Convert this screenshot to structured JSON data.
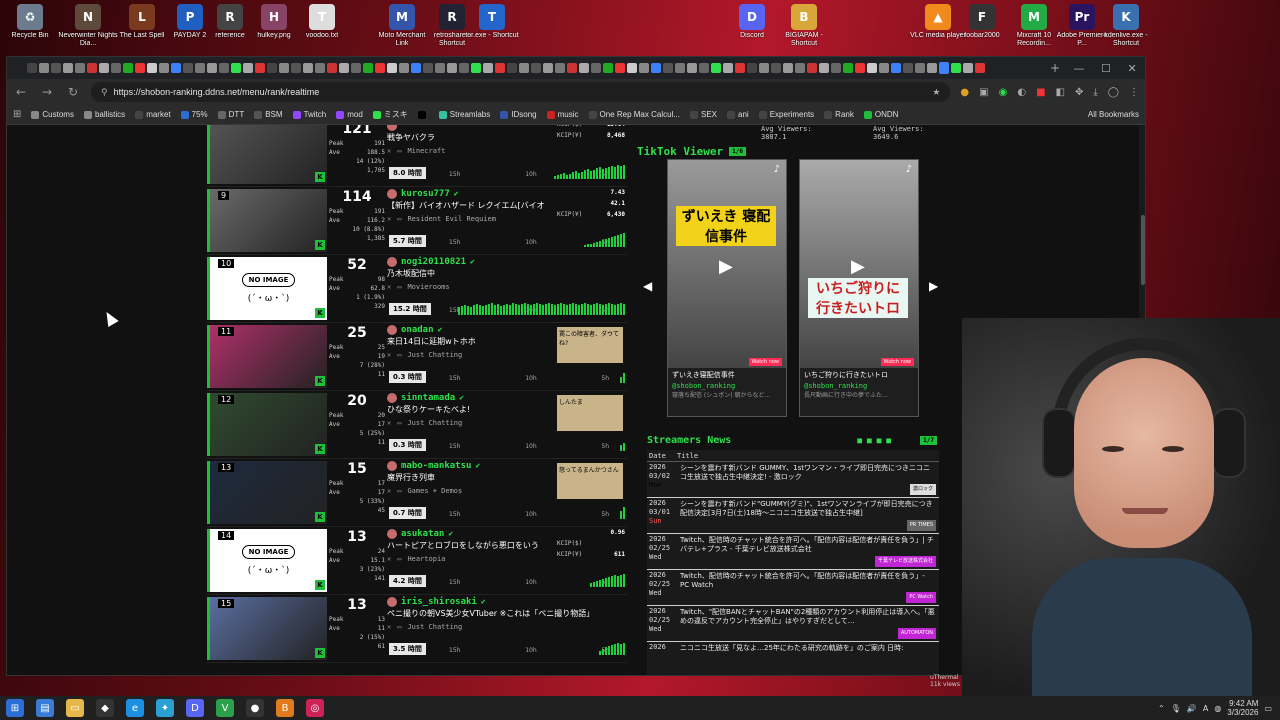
{
  "desktop": {
    "icons": [
      {
        "label": "Recycle Bin",
        "color": "#6b7c8f",
        "glyph": "♻"
      },
      {
        "label": "Neverwinter Nights Dia...",
        "color": "#5d4a3a",
        "glyph": "N"
      },
      {
        "label": "The Last Spell",
        "color": "#7a3a20",
        "glyph": "L"
      },
      {
        "label": "PAYDAY 2",
        "color": "#1f5fbf",
        "glyph": "P"
      },
      {
        "label": "reference",
        "color": "#444444",
        "glyph": "R"
      },
      {
        "label": "hulkey.png",
        "color": "#884466",
        "glyph": "H"
      },
      {
        "label": "voodoo.txt",
        "color": "#dddddd",
        "glyph": "T"
      },
      {
        "label": "Moto Merchant Link",
        "color": "#3355aa",
        "glyph": "M"
      },
      {
        "label": "retroshare - Shortcut",
        "color": "#222233",
        "glyph": "R"
      },
      {
        "label": "tor.exe - Shortcut",
        "color": "#2266cc",
        "glyph": "T"
      },
      {
        "label": "Discord",
        "color": "#5865f2",
        "glyph": "D"
      },
      {
        "label": "BIGIAPAM - Shortcut",
        "color": "#d9a63a",
        "glyph": "B"
      },
      {
        "label": "VLC media player",
        "color": "#f08a1c",
        "glyph": "▲"
      },
      {
        "label": "foobar2000",
        "color": "#333333",
        "glyph": "F"
      },
      {
        "label": "Mixcraft 10 Recordin...",
        "color": "#22aa44",
        "glyph": "M"
      },
      {
        "label": "Adobe Premiere P...",
        "color": "#2a1460",
        "glyph": "Pr"
      },
      {
        "label": "kdenlive.exe - Shortcut",
        "color": "#3a6fb0",
        "glyph": "K"
      }
    ]
  },
  "browser": {
    "url": "https://shobon-ranking.ddns.net/menu/rank/realtime",
    "window_controls": [
      "—",
      "☐",
      "✕"
    ],
    "new_tab": "+",
    "bookmarks": [
      {
        "label": "Customs",
        "color": "#888888"
      },
      {
        "label": "ballistics",
        "color": "#888888"
      },
      {
        "label": "market",
        "color": "#444444"
      },
      {
        "label": "75%",
        "color": "#2b6fd6"
      },
      {
        "label": "DTT",
        "color": "#666666"
      },
      {
        "label": "BSM",
        "color": "#555555"
      },
      {
        "label": "Twitch",
        "color": "#9146ff"
      },
      {
        "label": "mod",
        "color": "#9146ff"
      },
      {
        "label": "ミスキ",
        "color": "#2ee04b"
      },
      {
        "label": "",
        "color": "#000000"
      },
      {
        "label": "Streamlabs",
        "color": "#31c3a2"
      },
      {
        "label": "IDsong",
        "color": "#3355aa"
      },
      {
        "label": "music",
        "color": "#cc2222"
      },
      {
        "label": "One Rep Max Calcul...",
        "color": "#444444"
      },
      {
        "label": "SEX",
        "color": "#444444"
      },
      {
        "label": "ani",
        "color": "#444444"
      },
      {
        "label": "Experiments",
        "color": "#444444"
      },
      {
        "label": "Rank",
        "color": "#444444"
      },
      {
        "label": "ONDN",
        "color": "#1fbf3a"
      }
    ],
    "all_bookmarks": "All Bookmarks"
  },
  "ranking": {
    "rows": [
      {
        "rank": "",
        "viewers": "121",
        "stats": [
          [
            "Peak",
            "191"
          ],
          [
            "Ave",
            "188.5"
          ],
          [
            "",
            "14 (12%)"
          ],
          [
            "",
            "1,705"
          ]
        ],
        "name": "",
        "title": "戦争ヤバクラ",
        "category": "Minecraft",
        "duration": "8.0 時間",
        "kcip": [
          [
            "KCIP($)",
            "15.64"
          ],
          [
            "KCIP(¥)",
            "8,468"
          ]
        ],
        "mini": "",
        "noimg": false,
        "thumbColor": "#555555",
        "spark": [
          3,
          4,
          5,
          6,
          4,
          5,
          7,
          8,
          6,
          7,
          9,
          10,
          8,
          9,
          11,
          12,
          10,
          11,
          12,
          13,
          12,
          14,
          13,
          14
        ]
      },
      {
        "rank": "9",
        "viewers": "114",
        "stats": [
          [
            "Peak",
            "191"
          ],
          [
            "Ave",
            "116.2"
          ],
          [
            "",
            "10 (8.8%)"
          ],
          [
            "",
            "1,385"
          ]
        ],
        "name": "kurosu777",
        "title": "【新作】バイオハザード レクイエム[バイオ",
        "category": "Resident Evil Requiem",
        "duration": "5.7 時間",
        "kcip": [
          [
            "",
            "7.43"
          ],
          [
            "",
            "42.1"
          ],
          [
            "KCIP(¥)",
            "6,430"
          ]
        ],
        "mini": "",
        "noimg": false,
        "thumbColor": "#6a6a6a",
        "spark": [
          2,
          3,
          3,
          4,
          5,
          6,
          7,
          8,
          9,
          10,
          11,
          12,
          13,
          14
        ]
      },
      {
        "rank": "10",
        "viewers": "52",
        "stats": [
          [
            "Peak",
            "98"
          ],
          [
            "Ave",
            "62.8"
          ],
          [
            "",
            "1 (1.9%)"
          ],
          [
            "",
            "329"
          ]
        ],
        "name": "nogi20110821",
        "title": "乃木坂配信中",
        "category": "Movierooms",
        "duration": "15.2 時間",
        "kcip": [],
        "mini": "",
        "noimg": true,
        "thumbColor": "#ffffff",
        "spark": [
          8,
          9,
          10,
          9,
          8,
          10,
          11,
          10,
          9,
          10,
          11,
          12,
          10,
          11,
          9,
          10,
          11,
          10,
          12,
          11,
          10,
          11,
          12,
          11,
          10,
          11,
          12,
          11,
          10,
          11,
          12,
          11,
          10,
          11,
          12,
          11,
          10,
          11,
          12,
          11,
          10,
          11,
          12,
          11,
          10,
          11,
          12,
          11,
          10,
          11,
          12,
          11,
          10,
          11,
          12,
          11
        ]
      },
      {
        "rank": "11",
        "viewers": "25",
        "stats": [
          [
            "Peak",
            "25"
          ],
          [
            "Ave",
            "19"
          ],
          [
            "",
            "7 (28%)"
          ],
          [
            "",
            "11"
          ]
        ],
        "name": "onadan",
        "title": "来日14日に延期wトホホ",
        "category": "Just Chatting",
        "duration": "0.3 時間",
        "kcip": [],
        "mini": "罠この障害者、ダウてね?",
        "noimg": false,
        "thumbColor": "#b0306a",
        "spark": [
          6,
          10
        ]
      },
      {
        "rank": "12",
        "viewers": "20",
        "stats": [
          [
            "Peak",
            "20"
          ],
          [
            "Ave",
            "17"
          ],
          [
            "",
            "5 (25%)"
          ],
          [
            "",
            "11"
          ]
        ],
        "name": "sinntamada",
        "title": "ひな祭りケーキたべよ!",
        "category": "Just Chatting",
        "duration": "0.3 時間",
        "kcip": [],
        "mini": "しんたま",
        "noimg": false,
        "thumbColor": "#2f4a2f",
        "spark": [
          6,
          8
        ]
      },
      {
        "rank": "13",
        "viewers": "15",
        "stats": [
          [
            "Peak",
            "17"
          ],
          [
            "Ave",
            "17"
          ],
          [
            "",
            "5 (33%)"
          ],
          [
            "",
            "45"
          ]
        ],
        "name": "mabo-mankatsu",
        "title": "魔界行き列車",
        "category": "Games + Demos",
        "duration": "0.7 時間",
        "kcip": [],
        "mini": "怒ってるまんかつさん",
        "noimg": false,
        "thumbColor": "#1e2a3e",
        "spark": [
          8,
          12
        ]
      },
      {
        "rank": "14",
        "viewers": "13",
        "stats": [
          [
            "Peak",
            "24"
          ],
          [
            "Ave",
            "15.1"
          ],
          [
            "",
            "3 (23%)"
          ],
          [
            "",
            "141"
          ]
        ],
        "name": "asukatan",
        "title": "ハートピアとロブロをしながら悪口をいう",
        "category": "Heartopia",
        "duration": "4.2 時間",
        "kcip": [
          [
            "",
            "0.96"
          ],
          [
            "KCIP($)",
            ""
          ],
          [
            "KCIP(¥)",
            "611"
          ]
        ],
        "mini": "",
        "noimg": true,
        "thumbColor": "#ffffff",
        "spark": [
          4,
          5,
          6,
          7,
          8,
          9,
          10,
          11,
          12,
          11,
          12,
          13
        ]
      },
      {
        "rank": "15",
        "viewers": "13",
        "stats": [
          [
            "Peak",
            "13"
          ],
          [
            "Ave",
            "11"
          ],
          [
            "",
            "2 (15%)"
          ],
          [
            "",
            "61"
          ]
        ],
        "name": "iris_shirosaki",
        "title": "ペニ撮りの朝VS美少女VTuber ※これは「ペニ撮り物語」",
        "category": "Just Chatting",
        "duration": "3.5 時間",
        "kcip": [],
        "mini": "",
        "noimg": false,
        "thumbColor": "#5a6ea0",
        "spark": [
          4,
          6,
          8,
          9,
          10,
          11,
          12,
          11,
          12
        ]
      }
    ],
    "ticks": [
      "15h",
      "10h",
      "5h"
    ]
  },
  "right": {
    "avg": [
      "Avg Viewers: 3887.1",
      "Avg Viewers: 3649.6"
    ],
    "tiktok_title": "TikTok Viewer",
    "tiktok_badge": "1/6",
    "cards": [
      {
        "tag": "ずいえき 寝配信事件",
        "caption": "ずいえき寝配信事件",
        "user": "@shobon_ranking",
        "desc": "寝落ち配信 (シュボン) 朝からなど...",
        "watch": "Watch now",
        "bg": "#9a9a9a"
      },
      {
        "tag": "いちご狩りに 行きたいトロ",
        "caption": "いちご狩りに行きたいトロ",
        "user": "@shobon_ranking",
        "desc": "長尺動画に行き中の夢でふた...",
        "watch": "Watch now",
        "bg": "#aaaaaa"
      }
    ],
    "news_title": "Streamers News",
    "news_badge": "1/7",
    "news_cols": [
      "Date",
      "Title"
    ],
    "news": [
      {
        "y": "2026",
        "d": "03/02",
        "day": "Mon",
        "t": "シーンを震わす新バンド GUMMY、1stワンマン・ライブ即日完売につきニコニコ生放送で独占生中継決定! - 激ロック",
        "src": "激ロック",
        "srcColor": "#dddddd"
      },
      {
        "y": "2026",
        "d": "03/01",
        "day": "Sun",
        "t": "シーンを震わす新バンド\"GUMMY(グミ)\"、1stワンマンライブが即日完売につき配信決定[3月7日(土)18時〜ニコニコ生放送で独占生中継]",
        "src": "PR TIMES",
        "srcColor": "#666666"
      },
      {
        "y": "2026",
        "d": "02/25",
        "day": "Wed",
        "t": "Twitch、配信時のチャット統合を許可へ。「配信内容は配信者が責任を負う」| チバテレ+プラス - 千葉テレビ放送株式会社",
        "src": "千葉テレビ放送株式会社",
        "srcColor": "#c026d3"
      },
      {
        "y": "2026",
        "d": "02/25",
        "day": "Wed",
        "t": "Twitch、配信時のチャット統合を許可へ。「配信内容は配信者が責任を負う」- PC Watch",
        "src": "PC Watch",
        "srcColor": "#c026d3"
      },
      {
        "y": "2026",
        "d": "02/25",
        "day": "Wed",
        "t": "Twitch、\"配信BANとチャットBAN\"の2種類のアカウント利用停止は導入へ。「悪めの違反でアカウント完全停止」はやりすぎだとして...",
        "src": "AUTOMATON",
        "srcColor": "#c026d3"
      },
      {
        "y": "2026",
        "d": "",
        "day": "",
        "t": "ニコニコ生放送「見なよ…25年にわたる研究の軌跡を」のご案内 日時:",
        "src": "",
        "srcColor": "#000000"
      }
    ],
    "thermal": "uThermal",
    "views": "11k views"
  },
  "taskbar": {
    "icons": [
      {
        "name": "start-icon",
        "color": "#2b6fd6",
        "glyph": "⊞"
      },
      {
        "name": "files-icon",
        "color": "#3a7bd5",
        "glyph": "▤"
      },
      {
        "name": "folder-icon",
        "color": "#e6b84a",
        "glyph": "▭"
      },
      {
        "name": "app-icon",
        "color": "#333333",
        "glyph": "◆"
      },
      {
        "name": "edge-icon",
        "color": "#1d8fe0",
        "glyph": "e"
      },
      {
        "name": "app2-icon",
        "color": "#2aa0d0",
        "glyph": "✦"
      },
      {
        "name": "discord-icon",
        "color": "#5865f2",
        "glyph": "D"
      },
      {
        "name": "app3-icon",
        "color": "#2aa04a",
        "glyph": "V"
      },
      {
        "name": "obs-icon",
        "color": "#333333",
        "glyph": "●"
      },
      {
        "name": "app4-icon",
        "color": "#e07a1c",
        "glyph": "B"
      },
      {
        "name": "app5-icon",
        "color": "#cc2255",
        "glyph": "◎"
      }
    ],
    "lang": "A",
    "time": "9:42 AM",
    "date": "3/3/2026"
  }
}
